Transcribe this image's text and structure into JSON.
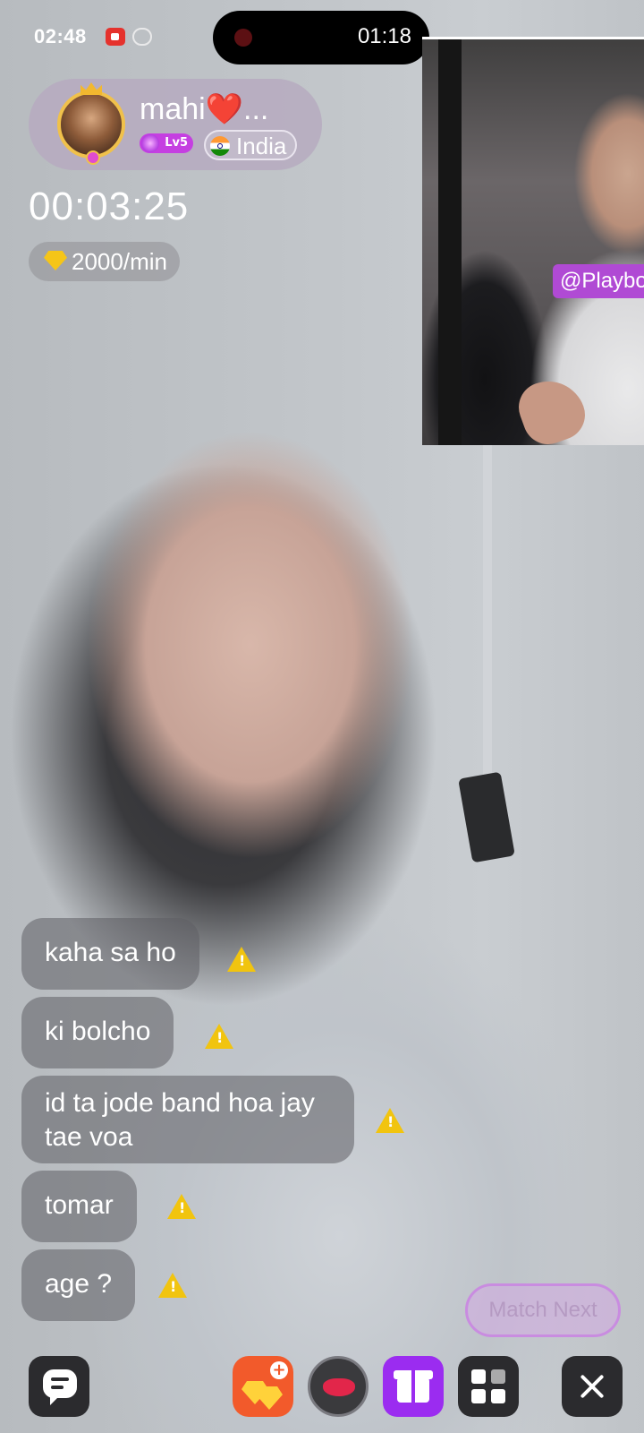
{
  "status_bar": {
    "time": "02:48",
    "call_time": "01:18"
  },
  "pip": {
    "watermark": "@Playbo"
  },
  "profile": {
    "name": "mahi❤️...",
    "level": "Lv5",
    "country": "India"
  },
  "call": {
    "timer": "00:03:25",
    "rate": "2000/min"
  },
  "messages": [
    {
      "text": "kaha sa ho"
    },
    {
      "text": "ki bolcho"
    },
    {
      "text": "id ta jode band hoa jay tae voa"
    },
    {
      "text": "tomar"
    },
    {
      "text": "age ?"
    }
  ],
  "actions": {
    "match_next": "Match Next"
  },
  "icons": {
    "status": [
      "screen-record-icon",
      "cast-icon"
    ],
    "bottom_bar": [
      "chat-icon",
      "coins-add-icon",
      "lips-effect-icon",
      "gift-icon",
      "grid-menu-icon",
      "close-icon"
    ],
    "message_flag": "warning-icon"
  },
  "colors": {
    "accent_purple": "#9b2cf0",
    "coins_orange": "#f25a2b",
    "warning_yellow": "#f1c40f",
    "level_badge": "#c53fe1"
  }
}
